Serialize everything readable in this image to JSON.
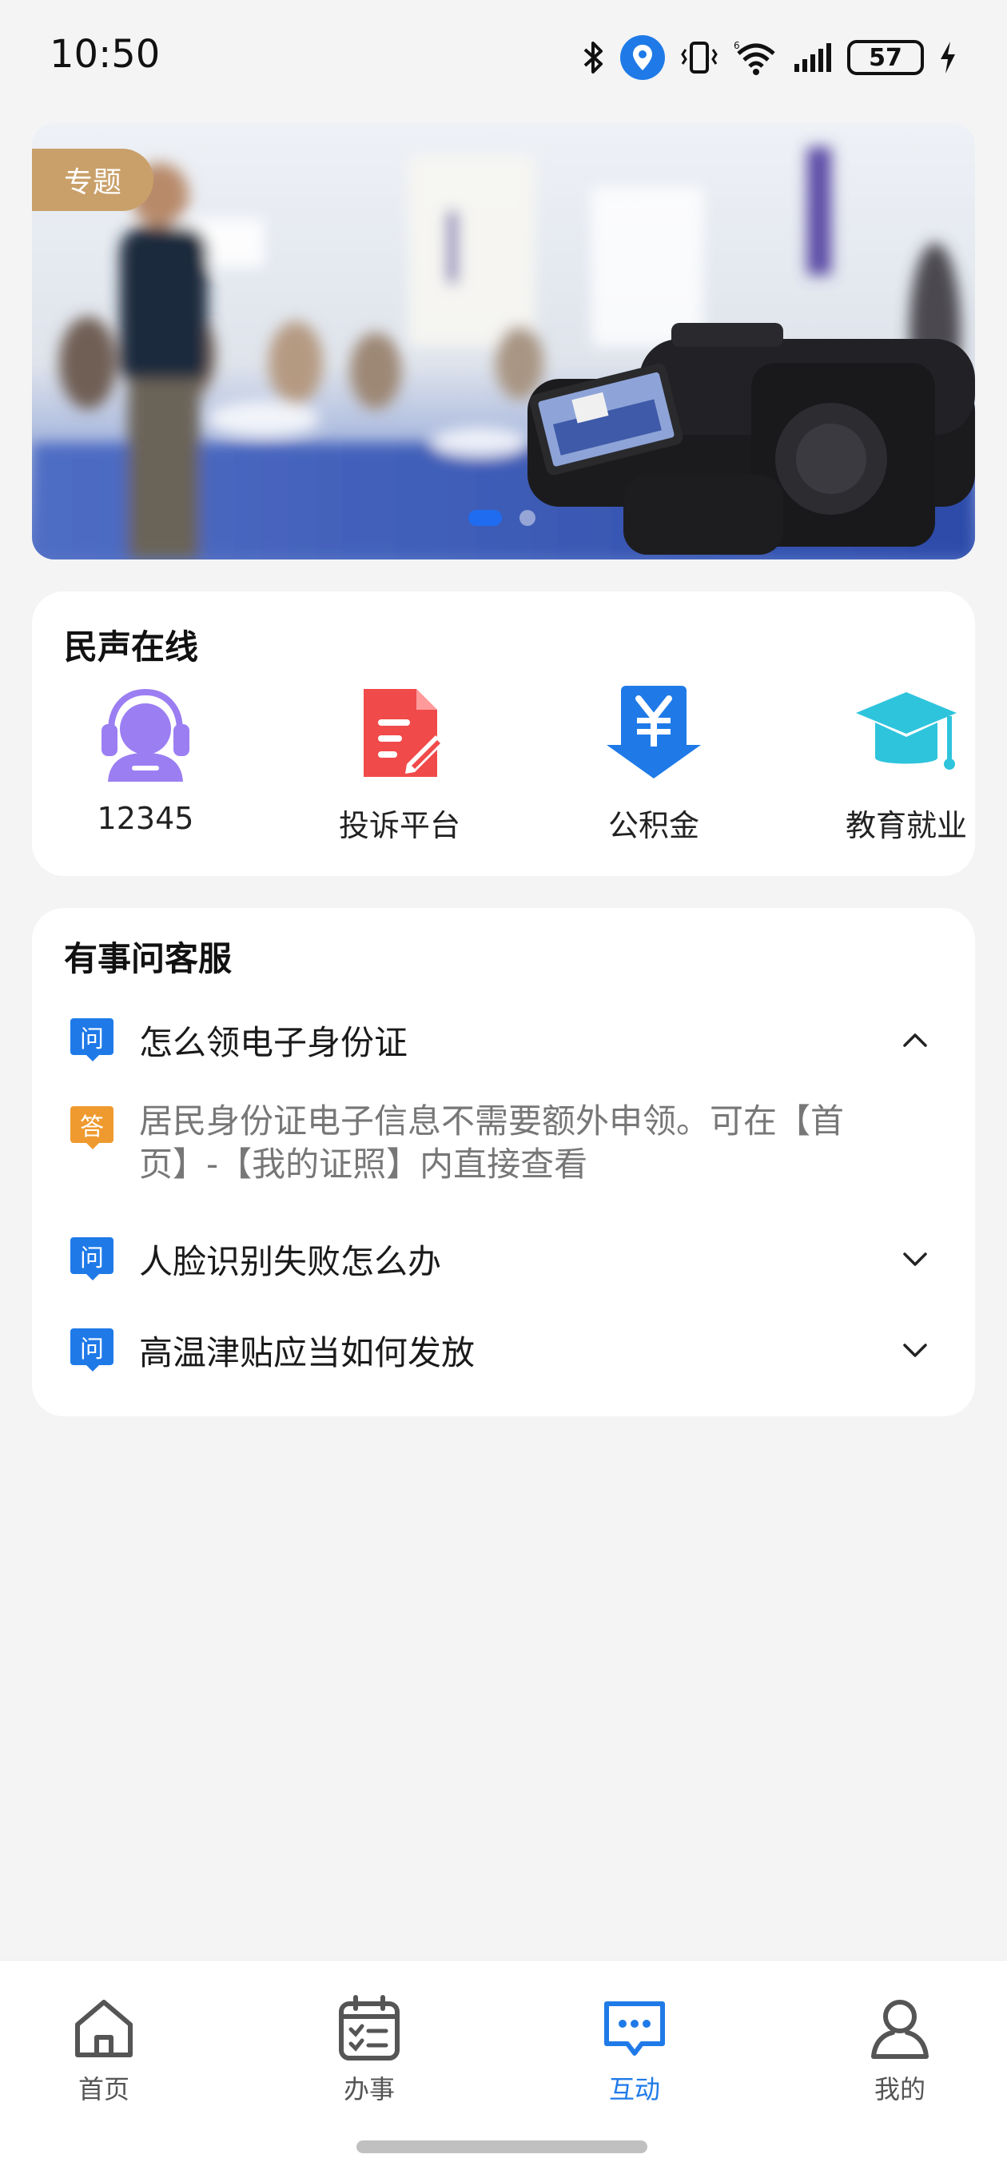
{
  "status_bar": {
    "time": "10:50",
    "battery": "57",
    "icons": [
      "bluetooth-icon",
      "location-icon",
      "vibrate-icon",
      "wifi-6-icon",
      "signal-icon",
      "battery-icon",
      "charging-icon"
    ]
  },
  "banner": {
    "tag": "专题",
    "slide_count": 2,
    "active_slide": 1
  },
  "services": {
    "title": "民声在线",
    "items": [
      {
        "label": "12345",
        "icon": "customer-service-icon",
        "color": "#9b7ef2"
      },
      {
        "label": "投诉平台",
        "icon": "complaint-document-icon",
        "color": "#f04a4a"
      },
      {
        "label": "公积金",
        "icon": "housing-fund-yen-icon",
        "color": "#1f7ae8"
      },
      {
        "label": "教育就业",
        "icon": "graduation-cap-icon",
        "color": "#2ec4dc"
      }
    ]
  },
  "faq": {
    "title": "有事问客服",
    "q_badge": "问",
    "a_badge": "答",
    "items": [
      {
        "question": "怎么领电子身份证",
        "expanded": true,
        "answer_line1": "居民身份证电子信息不需要额外申领。可在【首",
        "answer_line2": "页】-【我的证照】内直接查看"
      },
      {
        "question": "人脸识别失败怎么办",
        "expanded": false
      },
      {
        "question": "高温津贴应当如何发放",
        "expanded": false
      }
    ]
  },
  "bottom_nav": {
    "items": [
      {
        "label": "首页",
        "icon": "home-icon",
        "active": false
      },
      {
        "label": "办事",
        "icon": "calendar-tasks-icon",
        "active": false
      },
      {
        "label": "互动",
        "icon": "chat-bubble-icon",
        "active": true
      },
      {
        "label": "我的",
        "icon": "person-icon",
        "active": false
      }
    ]
  },
  "colors": {
    "accent": "#1f7ae8",
    "banner_tag": "#c9a06a",
    "answer_badge": "#ef9a2f",
    "background": "#f4f4f5"
  }
}
